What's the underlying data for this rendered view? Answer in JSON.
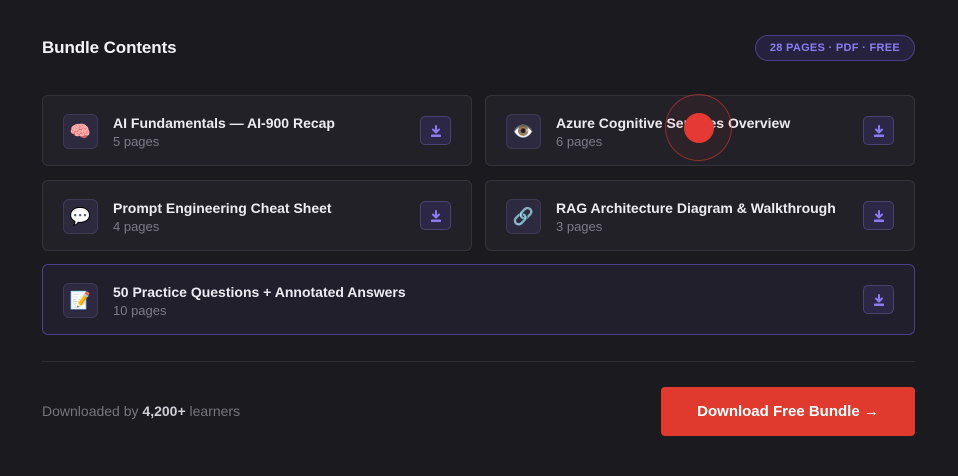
{
  "header": {
    "title": "Bundle Contents",
    "badge": "28 PAGES · PDF · FREE"
  },
  "items": [
    {
      "icon": "brain-icon",
      "glyph": "🧠",
      "name": "AI Fundamentals — AI-900 Recap",
      "pages": "5 pages"
    },
    {
      "icon": "eye-icon",
      "glyph": "👁️",
      "name": "Azure Cognitive Services Overview",
      "pages": "6 pages"
    },
    {
      "icon": "speech-bubble-icon",
      "glyph": "💬",
      "name": "Prompt Engineering Cheat Sheet",
      "pages": "4 pages"
    },
    {
      "icon": "link-icon",
      "glyph": "🔗",
      "name": "RAG Architecture Diagram & Walkthrough",
      "pages": "3 pages"
    },
    {
      "icon": "memo-icon",
      "glyph": "📝",
      "name": "50 Practice Questions + Annotated Answers",
      "pages": "10 pages"
    }
  ],
  "footer": {
    "prefix": "Downloaded by ",
    "count": "4,200+",
    "suffix": " learners",
    "cta_label": "Download Free Bundle →"
  },
  "colors": {
    "accent": "#8b7cf6",
    "cta": "#e03a2e",
    "background": "#1b1a1f"
  }
}
